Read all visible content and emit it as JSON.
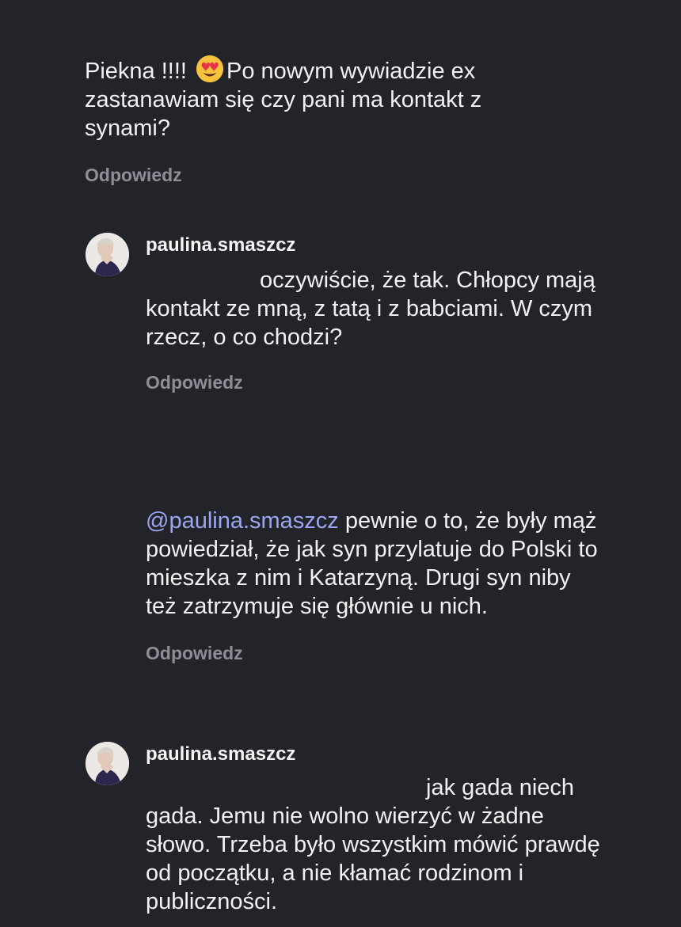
{
  "comments": [
    {
      "text_before_emoji": "Piekna !!!! ",
      "emoji": "heart-eyes-emoji",
      "text_after_emoji": "Po nowym wywiadzie ex zastanawiam się czy pani ma kontakt z synami?",
      "reply_label": "Odpowiedz"
    },
    {
      "username": "paulina.smaszcz",
      "text": "oczywiście, że tak. Chłopcy mają kontakt ze mną, z tatą i z babciami. W czym rzecz,  o co chodzi?",
      "reply_label": "Odpowiedz"
    },
    {
      "mention": "@paulina.smaszcz",
      "text": " pewnie o to, że były mąż powiedział, że jak syn przylatuje do Polski to mieszka z nim i Katarzyną. Drugi syn niby też zatrzymuje się głównie u nich.",
      "reply_label": "Odpowiedz"
    },
    {
      "username": "paulina.smaszcz",
      "text": "jak gada niech gada. Jemu nie wolno wierzyć w żadne słowo. Trzeba było wszystkim mówić prawdę od początku, a nie kłamać rodzinom i publiczności."
    }
  ],
  "colors": {
    "background": "#23242a",
    "text": "#f2f2f2",
    "muted": "#8e8f96",
    "mention": "#9aa6f0"
  }
}
